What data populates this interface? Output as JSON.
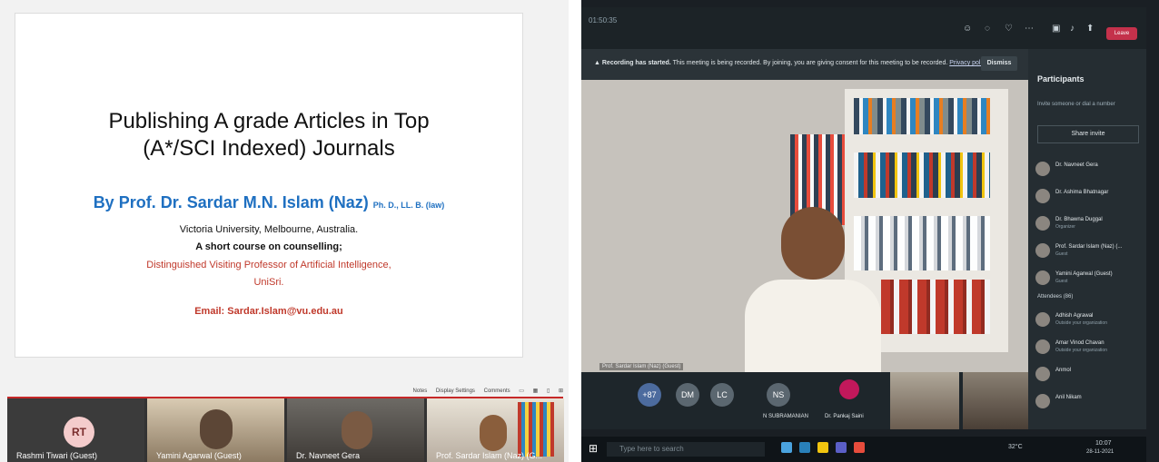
{
  "slide": {
    "title_line1": "Publishing  A grade Articles in  Top",
    "title_line2": "(A*/SCI  Indexed) Journals",
    "author": "By Prof. Dr. Sardar M.N. Islam (Naz)",
    "degrees": "Ph. D., LL. B. (law)",
    "affiliation": "Victoria University, Melbourne, Australia.",
    "course": "A short course on counselling;",
    "role_line1": "Distinguished Visiting Professor of Artificial Intelligence,",
    "role_line2": "UniSri.",
    "email": "Email: Sardar.Islam@vu.edu.au"
  },
  "view_bar": {
    "notes": "Notes",
    "display_settings": "Display Settings",
    "comments": "Comments"
  },
  "participants_strip": [
    {
      "initials": "RT",
      "name": "Rashmi Tiwari (Guest)"
    },
    {
      "name": "Yamini Agarwal (Guest)"
    },
    {
      "name": "Dr. Navneet Gera"
    },
    {
      "name": "Prof. Sardar Islam (Naz) (G..."
    }
  ],
  "meeting": {
    "timer": "01:50:35",
    "leave": "Leave",
    "recording_title": "Recording has started.",
    "recording_msg": "This meeting is being recorded. By joining, you are giving consent for this meeting to be recorded.",
    "privacy": "Privacy policy",
    "dismiss": "Dismiss",
    "video_label": "Prof. Sardar Islam (Naz) (Guest)",
    "panel_title": "Participants",
    "invite_placeholder": "Invite someone or dial a number",
    "share_invite": "Share invite",
    "presenters": [
      {
        "name": "Dr. Navneet Gera",
        "sub": ""
      },
      {
        "name": "Dr. Ashima Bhatnagar",
        "sub": ""
      },
      {
        "name": "Dr. Bhawna Duggal",
        "sub": "Organizer"
      },
      {
        "name": "Prof. Sardar Islam (Naz) (...",
        "sub": "Guest"
      },
      {
        "name": "Yamini Agarwal (Guest)",
        "sub": "Guest"
      }
    ],
    "attendees_label": "Attendees (86)",
    "attendees": [
      {
        "name": "Adhish Agrawal",
        "sub": "Outside your organization"
      },
      {
        "name": "Amar Vinod Chavan",
        "sub": "Outside your organization"
      },
      {
        "name": "Anmol",
        "sub": ""
      },
      {
        "name": "Anil Nikam",
        "sub": ""
      }
    ],
    "bottom": {
      "more": "+87",
      "dm": "DM",
      "lc": "LC",
      "ns": "NS",
      "ns_name": "N SUBRAMANIAN",
      "pankaj": "Dr. Pankaj Saini"
    },
    "taskbar_search": "Type here to search",
    "temp": "32°C",
    "clock": "10:07",
    "date": "28-11-2021"
  }
}
